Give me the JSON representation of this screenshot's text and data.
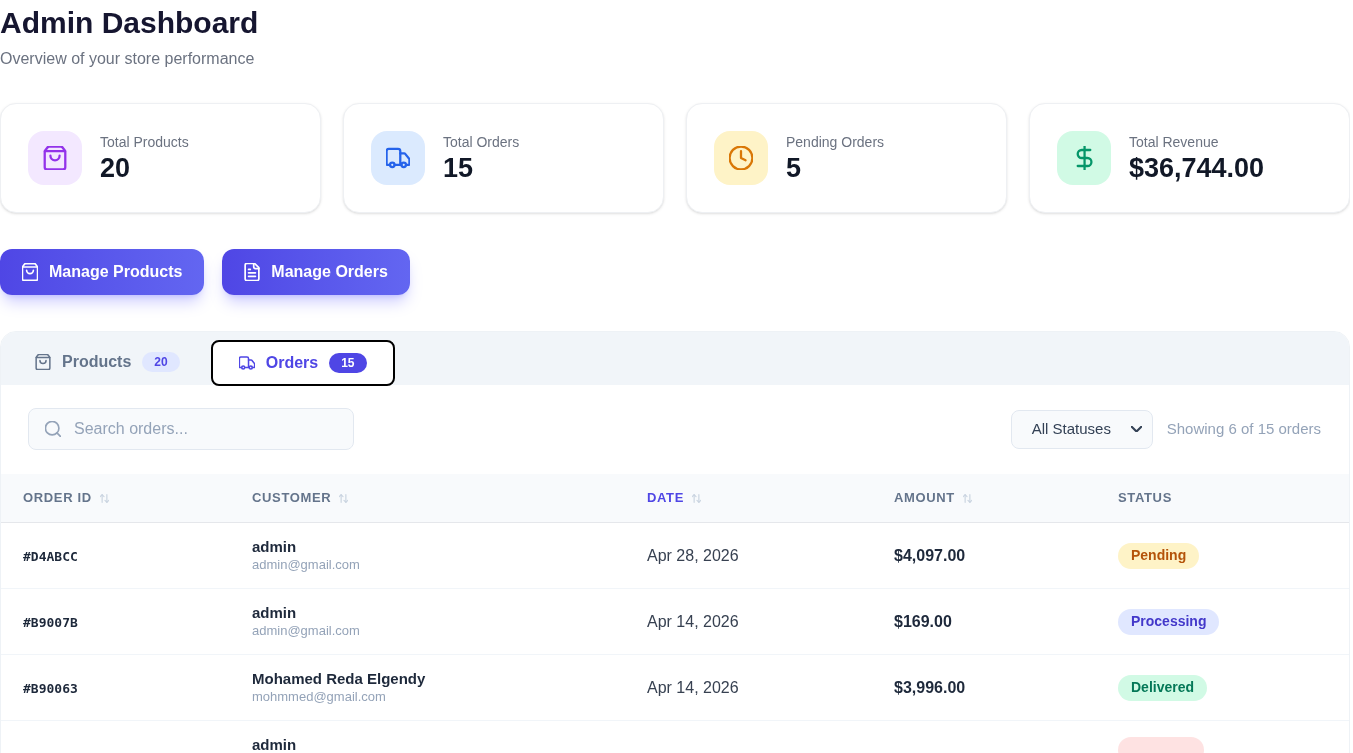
{
  "page": {
    "title": "Admin Dashboard",
    "subtitle": "Overview of your store performance"
  },
  "stats": [
    {
      "kind": "products",
      "label": "Total Products",
      "value": "20"
    },
    {
      "kind": "orders",
      "label": "Total Orders",
      "value": "15"
    },
    {
      "kind": "pending",
      "label": "Pending Orders",
      "value": "5"
    },
    {
      "kind": "revenue",
      "label": "Total Revenue",
      "value": "$36,744.00"
    }
  ],
  "actions": [
    {
      "kind": "products",
      "label": "Manage Products"
    },
    {
      "kind": "orders",
      "label": "Manage Orders"
    }
  ],
  "tabs": [
    {
      "kind": "products",
      "label": "Products",
      "count": "20",
      "selected": false
    },
    {
      "kind": "orders",
      "label": "Orders",
      "count": "15",
      "selected": true
    }
  ],
  "toolbar": {
    "search": {
      "placeholder": "Search orders..."
    },
    "status_filter": {
      "value": "All Statuses"
    },
    "summary": "Showing 6 of 15 orders"
  },
  "table": {
    "columns": [
      {
        "label": "ORDER ID",
        "sortable": true,
        "selected": false
      },
      {
        "label": "CUSTOMER",
        "sortable": true,
        "selected": false
      },
      {
        "label": "DATE",
        "sortable": true,
        "selected": true
      },
      {
        "label": "AMOUNT",
        "sortable": true,
        "selected": false
      },
      {
        "label": "STATUS",
        "sortable": false,
        "selected": false
      }
    ],
    "rows": [
      {
        "order_id": "#D4ABCC",
        "customer": {
          "name": "admin",
          "email": "admin@gmail.com"
        },
        "date": "Apr 28, 2026",
        "amount": "$4,097.00",
        "status": {
          "label": "Pending",
          "color": "#fef3c7"
        }
      },
      {
        "order_id": "#B9007B",
        "customer": {
          "name": "admin",
          "email": "admin@gmail.com"
        },
        "date": "Apr 14, 2026",
        "amount": "$169.00",
        "status": {
          "label": "Processing",
          "color": "#e0e7ff"
        }
      },
      {
        "order_id": "#B90063",
        "customer": {
          "name": "Mohamed Reda Elgendy",
          "email": "mohmmed@gmail.com"
        },
        "date": "Apr 14, 2026",
        "amount": "$3,996.00",
        "status": {
          "label": "Delivered",
          "color": "#d1fae5"
        }
      },
      {
        "customer": {
          "name": "admin"
        },
        "status": {
          "color": "#fee2e2"
        }
      }
    ]
  }
}
